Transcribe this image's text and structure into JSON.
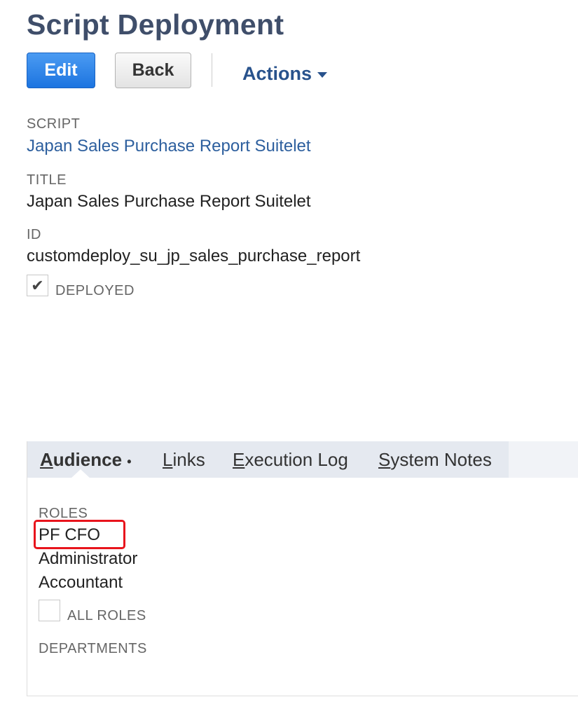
{
  "page": {
    "title": "Script Deployment"
  },
  "toolbar": {
    "edit_label": "Edit",
    "back_label": "Back",
    "actions_label": "Actions"
  },
  "fields": {
    "script": {
      "label": "SCRIPT",
      "value": "Japan Sales Purchase Report Suitelet"
    },
    "title": {
      "label": "TITLE",
      "value": "Japan Sales Purchase Report Suitelet"
    },
    "id": {
      "label": "ID",
      "value": "customdeploy_su_jp_sales_purchase_report"
    },
    "deployed": {
      "label": "DEPLOYED",
      "checked": true
    }
  },
  "tabs": [
    {
      "first": "A",
      "rest": "udience",
      "dot": "•",
      "active": true
    },
    {
      "first": "L",
      "rest": "inks",
      "active": false
    },
    {
      "first": "E",
      "rest": "xecution Log",
      "active": false
    },
    {
      "first": "S",
      "rest": "ystem Notes",
      "active": false
    }
  ],
  "audience": {
    "roles_label": "ROLES",
    "roles": [
      "PF CFO",
      "Administrator",
      "Accountant"
    ],
    "all_roles": {
      "label": "ALL ROLES",
      "checked": false
    },
    "departments_label": "DEPARTMENTS"
  },
  "annotation": {
    "highlight_color": "#e8141c"
  },
  "colors": {
    "title": "#3f4e6a",
    "primary": "#1c74e0",
    "link": "#2d5f9e"
  }
}
